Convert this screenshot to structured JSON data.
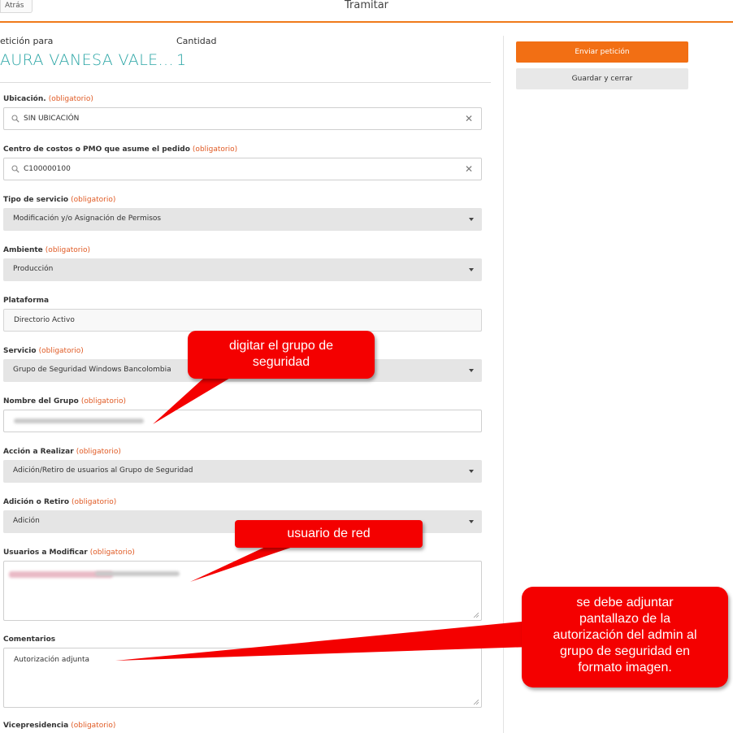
{
  "header": {
    "back_label": "Atrás",
    "title": "Tramitar"
  },
  "summary": {
    "recipient_label": "etición para",
    "recipient_value": "AURA VANESA VALE...",
    "quantity_label": "Cantidad",
    "quantity_value": "1"
  },
  "required_tag": "(obligatorio)",
  "fields": {
    "ubicacion": {
      "label": "Ubicación.",
      "value": "SIN UBICACIÓN"
    },
    "centro": {
      "label": "Centro de costos o PMO que asume el pedido",
      "value": "C100000100"
    },
    "tipo": {
      "label": "Tipo de servicio",
      "value": "Modificación y/o Asignación de Permisos"
    },
    "ambiente": {
      "label": "Ambiente",
      "value": "Producción"
    },
    "plataforma": {
      "label": "Plataforma",
      "value": "Directorio Activo"
    },
    "servicio": {
      "label": "Servicio",
      "value": "Grupo de Seguridad Windows Bancolombia"
    },
    "nombre_grupo": {
      "label": "Nombre del Grupo"
    },
    "accion": {
      "label": "Acción a Realizar",
      "value": "Adición/Retiro de usuarios al Grupo de Seguridad"
    },
    "adicion": {
      "label": "Adición o Retiro",
      "value": "Adición"
    },
    "usuarios": {
      "label": "Usuarios a Modificar"
    },
    "comentarios": {
      "label": "Comentarios",
      "value": "Autorización adjunta"
    },
    "vicepresidencia": {
      "label": "Vicepresidencia"
    }
  },
  "actions": {
    "submit_label": "Enviar petición",
    "save_label": "Guardar y cerrar"
  },
  "annotations": {
    "grupo": [
      "digitar el grupo de",
      "seguridad"
    ],
    "usuario": [
      "usuario de red"
    ],
    "adjunto": [
      "se debe adjuntar",
      "pantallazo de la",
      "autorización del admin al",
      "grupo de seguridad en",
      "formato imagen."
    ]
  },
  "colors": {
    "accent": "#f26f14",
    "teal": "#2aa5a5",
    "required": "#e05a24",
    "callout": "#f40000"
  },
  "icons": {
    "search": "search-icon",
    "clear": "close-icon",
    "dropdown": "caret-down-icon"
  }
}
